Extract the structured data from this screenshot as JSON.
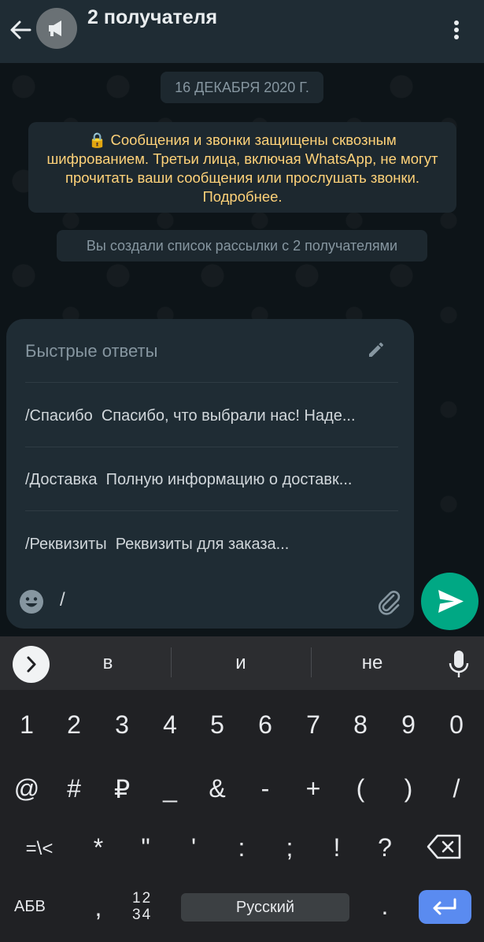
{
  "header": {
    "title": "2 получателя",
    "avatar_icon": "megaphone-icon",
    "back_icon": "arrow-left-icon",
    "menu_icon": "more-vertical-icon"
  },
  "chat": {
    "date_label": "16 ДЕКАБРЯ 2020 Г.",
    "encryption_notice": "🔒 Сообщения и звонки защищены сквозным шифрованием. Третьи лица, включая WhatsApp, не могут прочитать ваши сообщения или прослушать звонки. Подробнее.",
    "system_message": "Вы создали список рассылки с 2 получателями"
  },
  "quick_replies": {
    "header": "Быстрые ответы",
    "edit_icon": "pencil-icon",
    "items": [
      {
        "shortcut": "/Спасибо",
        "text": "Спасибо, что выбрали нас! Наде..."
      },
      {
        "shortcut": "/Доставка",
        "text": "Полную информацию о доставк..."
      },
      {
        "shortcut": "/Реквизиты",
        "text": "Реквизиты для заказа..."
      }
    ]
  },
  "composer": {
    "input_value": "/",
    "emoji_icon": "emoji-icon",
    "attach_icon": "paperclip-icon",
    "send_icon": "send-icon"
  },
  "keyboard": {
    "suggestions": [
      "в",
      "и",
      "не"
    ],
    "row1": [
      "1",
      "2",
      "3",
      "4",
      "5",
      "6",
      "7",
      "8",
      "9",
      "0"
    ],
    "row2": [
      "@",
      "#",
      "₽",
      "_",
      "&",
      "-",
      "+",
      "(",
      ")",
      "/"
    ],
    "row3": [
      "=\\<",
      "*",
      "\"",
      "'",
      ":",
      ";",
      "!",
      "?"
    ],
    "abv_label": "АБВ",
    "comma": ",",
    "numbers_toggle": "12\n34",
    "space_label": "Русский",
    "period": "."
  },
  "colors": {
    "accent": "#00a884",
    "header_bg": "#1f2c34",
    "encryption_text": "#ffd279",
    "enter_key": "#5a8bf0"
  }
}
